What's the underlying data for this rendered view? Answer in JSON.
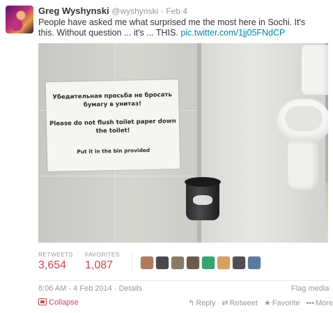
{
  "tweet": {
    "author_name": "Greg Wyshynski",
    "handle": "@wyshynski",
    "separator": "·",
    "date": "Feb 4",
    "text": "People have asked me what surprised me the most here in Sochi. It's this. Without question ... it's ... THIS. ",
    "link": "pic.twitter.com/1jj05FNdCP"
  },
  "photo": {
    "sign_russian": "Убедительная просьба не бросать бумагу в унитаз!",
    "sign_english": "Please do not flush toilet paper down the toilet!",
    "sign_bin": "Put it in the bin provided"
  },
  "stats": {
    "retweets_label": "RETWEETS",
    "retweets_value": "3,654",
    "favorites_label": "FAVORITES",
    "favorites_value": "1,087"
  },
  "favoriters": [
    {
      "icon": "avatar-icon",
      "color": "#b07a5a"
    },
    {
      "icon": "avatar-icon",
      "color": "#4a4a4a"
    },
    {
      "icon": "avatar-icon",
      "color": "#8a7a6a"
    },
    {
      "icon": "avatar-icon",
      "color": "#6a5a4a"
    },
    {
      "icon": "avatar-icon",
      "color": "#2fa870"
    },
    {
      "icon": "avatar-icon",
      "color": "#d8a060"
    },
    {
      "icon": "avatar-icon",
      "color": "#505050"
    },
    {
      "icon": "avatar-icon",
      "color": "#5a7aa0"
    }
  ],
  "meta": {
    "timestamp": "8:06 AM - 4 Feb 2014",
    "separator": "·",
    "details_label": "Details",
    "flag_label": "Flag media"
  },
  "actions": {
    "collapse_label": "Collapse",
    "reply_label": "Reply",
    "retweet_label": "Retweet",
    "favorite_label": "Favorite",
    "more_label": "More"
  },
  "colors": {
    "accent": "#d2444a",
    "link": "#0084b4",
    "muted": "#999999"
  }
}
